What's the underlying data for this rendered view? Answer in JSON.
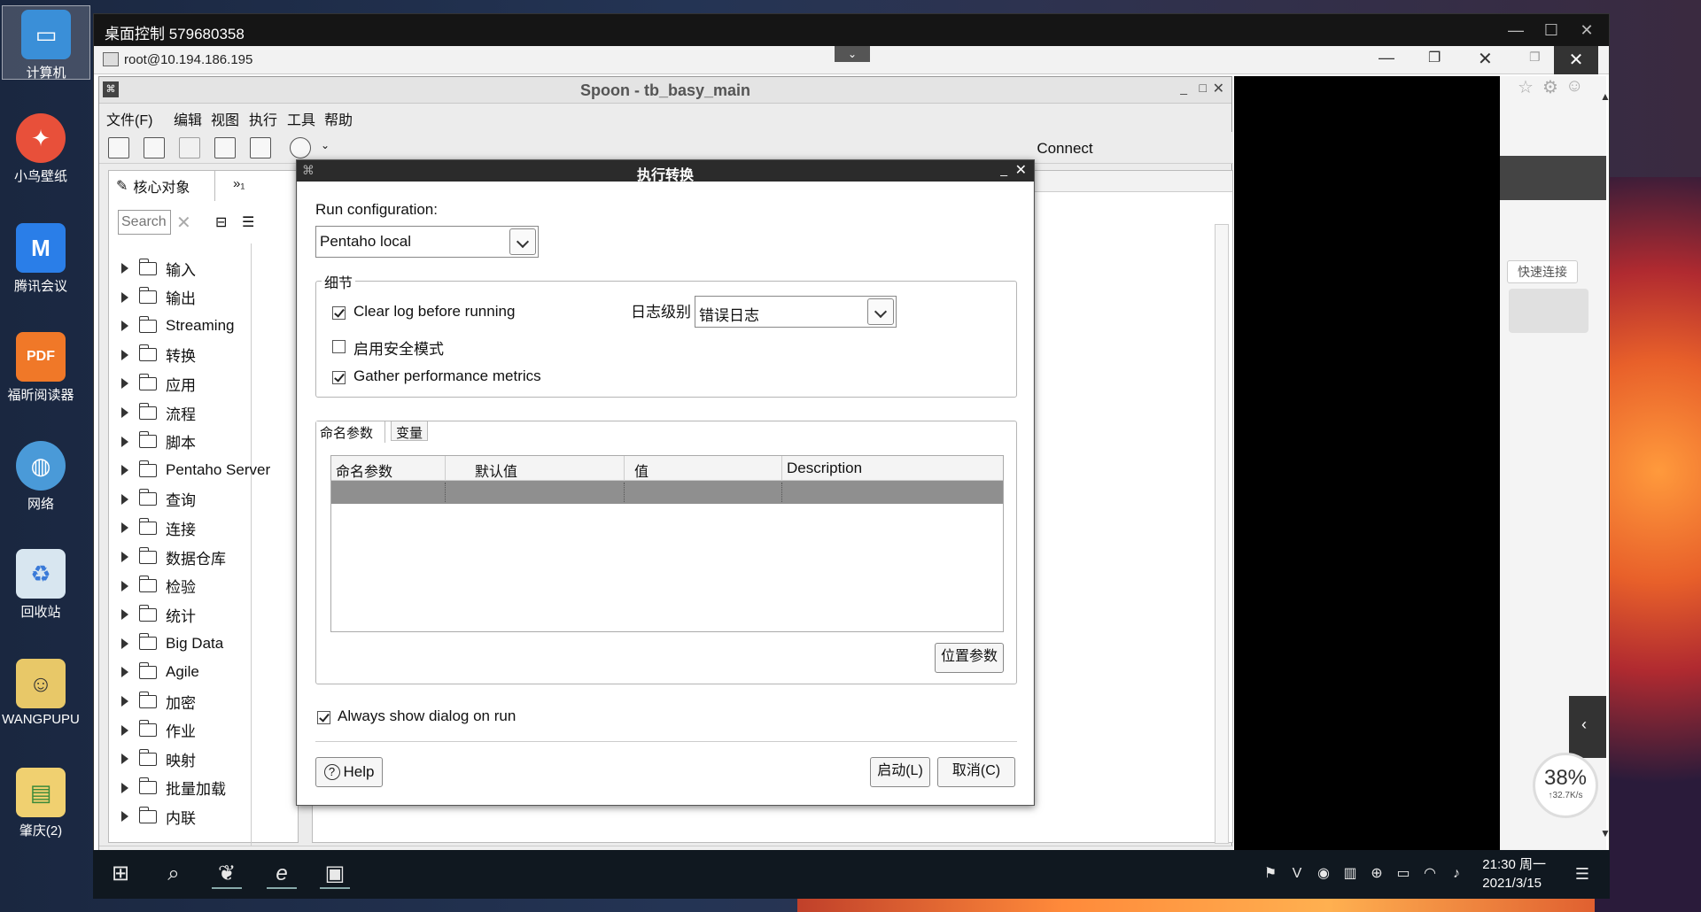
{
  "desktop": {
    "icons": [
      {
        "label": "计算机",
        "name": "computer"
      },
      {
        "label": "小鸟壁纸",
        "name": "bird-wallpaper"
      },
      {
        "label": "腾讯会议",
        "name": "tencent-meeting"
      },
      {
        "label": "福昕阅读器",
        "name": "foxit-reader"
      },
      {
        "label": "网络",
        "name": "network"
      },
      {
        "label": "回收站",
        "name": "recycle-bin"
      },
      {
        "label": "WANGPUPU",
        "name": "wangpupu"
      },
      {
        "label": "肇庆(2)",
        "name": "zhaoqing"
      }
    ]
  },
  "remote": {
    "title": "桌面控制 579680358",
    "ssh_title": "root@10.194.186.195"
  },
  "spoon": {
    "title": "Spoon - tb_basy_main",
    "menu": [
      "文件(F)",
      "编辑",
      "视图",
      "执行",
      "工具",
      "帮助"
    ],
    "connect": "Connect",
    "tab_core": "核心对象",
    "tab_more": "»₁",
    "search_placeholder": "Search",
    "tree": [
      "输入",
      "输出",
      "Streaming",
      "转换",
      "应用",
      "流程",
      "脚本",
      "Pentaho Server",
      "查询",
      "连接",
      "数据仓库",
      "检验",
      "统计",
      "Big Data",
      "Agile",
      "加密",
      "作业",
      "映射",
      "批量加载",
      "内联"
    ]
  },
  "dialog": {
    "title": "执行转换",
    "run_config_label": "Run configuration:",
    "run_config_value": "Pentaho local",
    "details_group": "细节",
    "clear_log": "Clear log before running",
    "safe_mode": "启用安全模式",
    "gather_metrics": "Gather performance metrics",
    "log_level_label": "日志级别",
    "log_level_value": "错误日志",
    "tab_params": "命名参数",
    "tab_vars": "变量",
    "columns": [
      "命名参数",
      "默认值",
      "值",
      "Description"
    ],
    "position_params": "位置参数",
    "always_show": "Always show dialog on run",
    "help": "Help",
    "launch": "启动(L)",
    "cancel": "取消(C)"
  },
  "right_panel": {
    "quick_connect": "快速连接",
    "speed_percent": "38%",
    "speed_rate": "↑32.7K/s"
  },
  "taskbar": {
    "time": "21:30 周一",
    "date": "2021/3/15"
  }
}
